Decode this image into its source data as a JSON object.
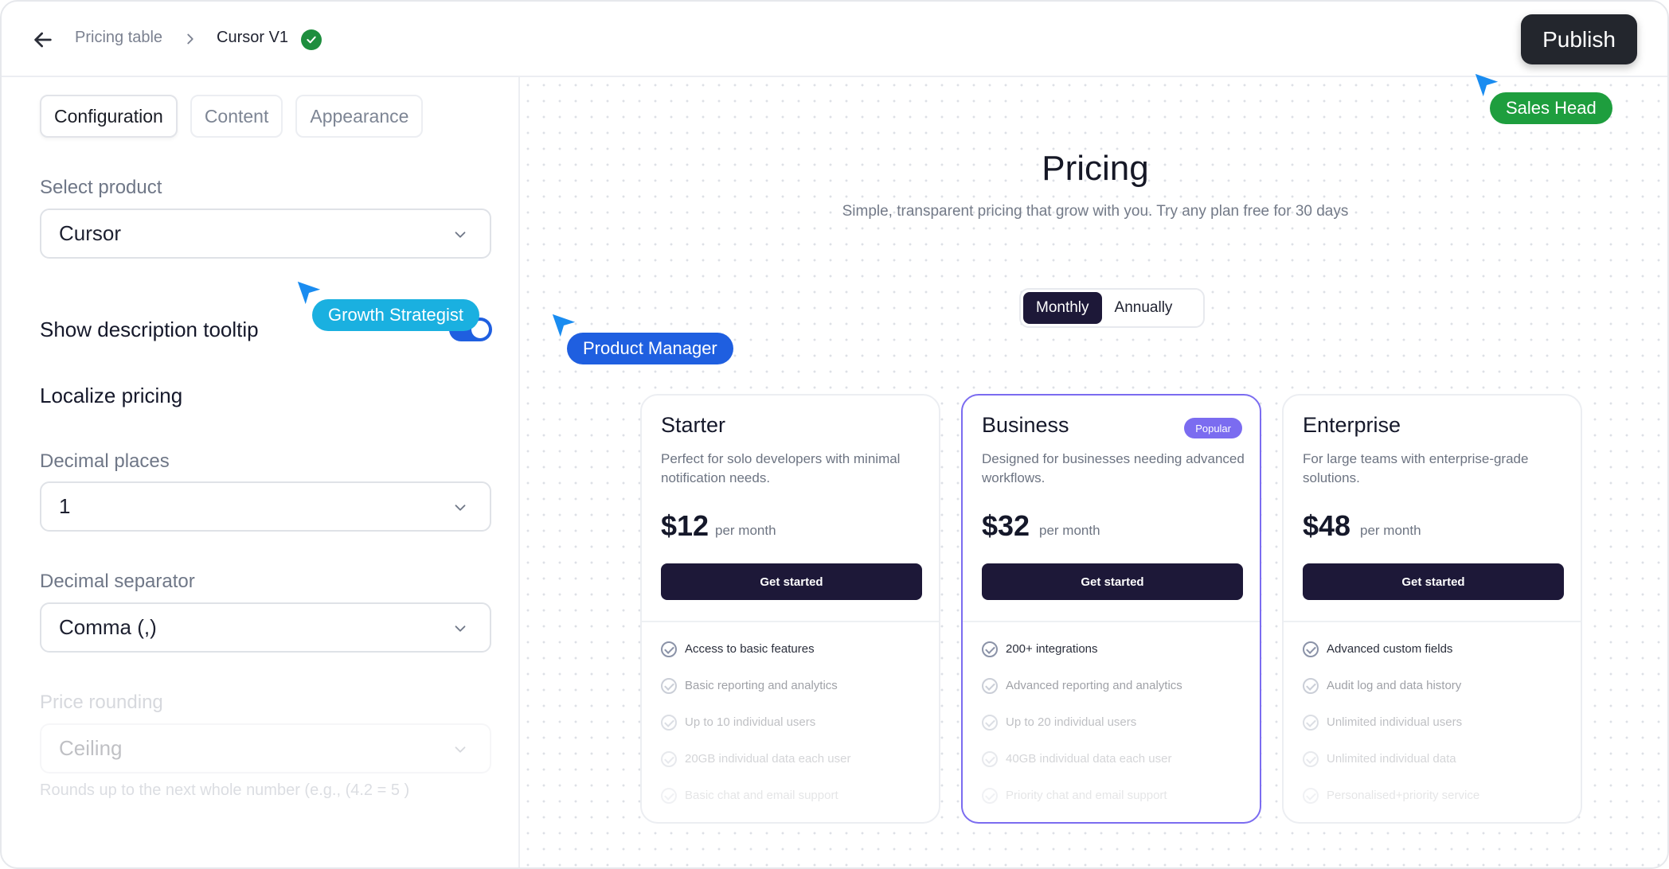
{
  "header": {
    "back_label": "Back",
    "breadcrumb_parent": "Pricing table",
    "breadcrumb_current": "Cursor V1",
    "publish_label": "Publish"
  },
  "sidebar": {
    "tabs": [
      {
        "label": "Configuration",
        "active": true
      },
      {
        "label": "Content",
        "active": false
      },
      {
        "label": "Appearance",
        "active": false
      }
    ],
    "select_product": {
      "label": "Select product",
      "value": "Cursor"
    },
    "show_description_tooltip": {
      "label": "Show description tooltip",
      "enabled": true
    },
    "localize_pricing": {
      "label": "Localize pricing"
    },
    "decimal_places": {
      "label": "Decimal places",
      "value": "1"
    },
    "decimal_separator": {
      "label": "Decimal separator",
      "value": "Comma (,)"
    },
    "price_rounding": {
      "label": "Price rounding",
      "value": "Ceiling",
      "hint": "Rounds up to the next whole number (e.g., (4.2 = 5 )"
    }
  },
  "preview": {
    "title": "Pricing",
    "subtitle": "Simple, transparent pricing that grow with you. Try any plan free for 30 days",
    "billing": {
      "monthly": "Monthly",
      "annually": "Annually",
      "selected": "Monthly"
    },
    "plans": [
      {
        "name": "Starter",
        "badge": "",
        "description": "Perfect for solo developers with minimal notification needs.",
        "price": "$12",
        "period": "per month",
        "cta": "Get started",
        "features": [
          "Access to basic features",
          "Basic reporting and analytics",
          "Up to 10 individual users",
          "20GB individual data each user",
          "Basic chat and email support"
        ]
      },
      {
        "name": "Business",
        "badge": "Popular",
        "description": "Designed for businesses needing advanced workflows.",
        "price": "$32",
        "period": "per month",
        "cta": "Get started",
        "features": [
          "200+ integrations",
          "Advanced reporting and analytics",
          "Up to 20 individual users",
          "40GB individual data each user",
          "Priority chat and email support"
        ]
      },
      {
        "name": "Enterprise",
        "badge": "",
        "description": "For large teams with enterprise-grade solutions.",
        "price": "$48",
        "period": "per month",
        "cta": "Get started",
        "features": [
          "Advanced custom fields",
          "Audit log and data history",
          "Unlimited individual users",
          "Unlimited individual data",
          "Personalised+priority service"
        ]
      }
    ]
  },
  "collaborators": [
    {
      "name": "Sales Head",
      "color": "#1e9e3e"
    },
    {
      "name": "Growth Strategist",
      "color": "#1ab0e0"
    },
    {
      "name": "Product Manager",
      "color": "#1f5fe0"
    }
  ],
  "colors": {
    "accent": "#1d1838",
    "popular": "#7b6cf0",
    "toggle": "#1f5fe0",
    "verified": "#1e8e3e"
  }
}
